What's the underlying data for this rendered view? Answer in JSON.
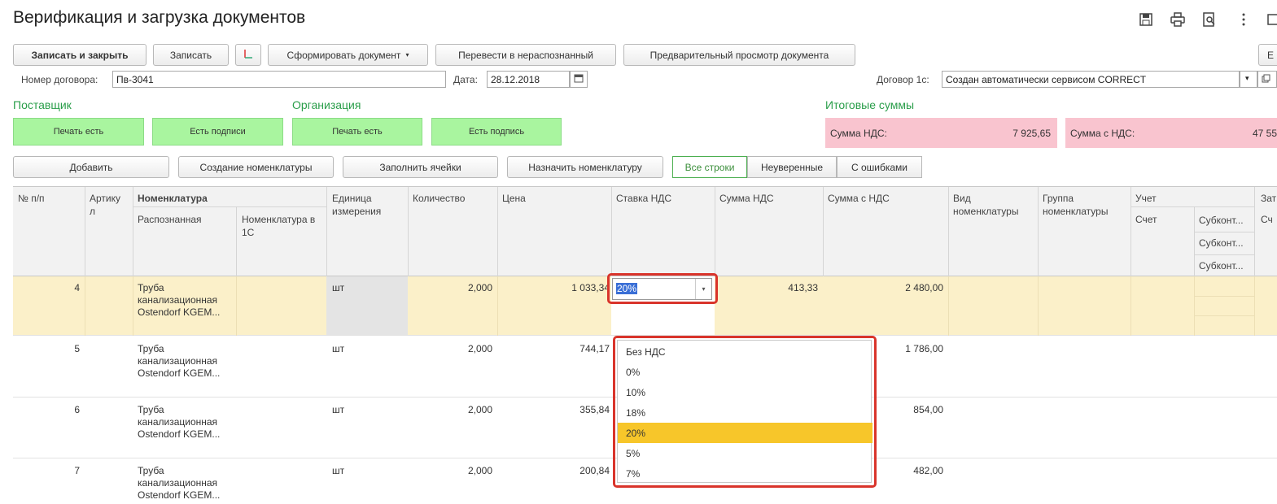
{
  "title": "Верификация и загрузка документов",
  "toolbar": {
    "save_close": "Записать и закрыть",
    "save": "Записать",
    "form_doc": "Сформировать документ",
    "to_unrecognized": "Перевести в нераспознанный",
    "preview": "Предварительный просмотр документа",
    "more": "Е"
  },
  "form": {
    "contract_label": "Номер договора:",
    "contract_value": "Пв-3041",
    "date_label": "Дата:",
    "date_value": "28.12.2018",
    "contract1c_label": "Договор 1с:",
    "contract1c_value": "Создан автоматически сервисом CORRECT"
  },
  "sections": {
    "supplier": "Поставщик",
    "org": "Организация",
    "totals": "Итоговые суммы"
  },
  "status": {
    "sup_stamp": "Печать есть",
    "sup_sign": "Есть подписи",
    "org_stamp": "Печать есть",
    "org_sign": "Есть подпись"
  },
  "totals": {
    "vat_label": "Сумма НДС:",
    "vat_value": "7 925,65",
    "with_vat_label": "Сумма с НДС:",
    "with_vat_value": "47 55"
  },
  "actions": {
    "add": "Добавить",
    "create_nom": "Создание номенклатуры",
    "fill": "Заполнить ячейки",
    "assign": "Назначить номенклатуру",
    "filter_all": "Все строки",
    "filter_uncertain": "Неуверенные",
    "filter_errors": "С ошибками"
  },
  "columns": {
    "num": "№ п/п",
    "article": "Артику л",
    "nom": "Номенклатура",
    "recognized": "Распознанная",
    "nom1c": "Номенклатура в 1С",
    "unit": "Единица измерения",
    "qty": "Количество",
    "price": "Цена",
    "vat_rate": "Ставка НДС",
    "vat_sum": "Сумма НДС",
    "sum_vat": "Сумма с НДС",
    "nom_type": "Вид номенклатуры",
    "nom_group": "Группа номенклатуры",
    "account": "Учет",
    "acc": "Счет",
    "sub1": "Субконт...",
    "sub2": "Субконт...",
    "sub3": "Субконт...",
    "za": "Зат",
    "sch": "Сч"
  },
  "rows": [
    {
      "num": "4",
      "name": "Труба канализационная Ostendorf KGEM...",
      "unit": "шт",
      "qty": "2,000",
      "price": "1 033,34",
      "vat_rate": "20%",
      "vat_sum": "413,33",
      "sum": "2 480,00"
    },
    {
      "num": "5",
      "name": "Труба канализационная Ostendorf KGEM...",
      "unit": "шт",
      "qty": "2,000",
      "price": "744,17",
      "sum": "1 786,00"
    },
    {
      "num": "6",
      "name": "Труба канализационная Ostendorf KGEM...",
      "unit": "шт",
      "qty": "2,000",
      "price": "355,84",
      "sum": "854,00"
    },
    {
      "num": "7",
      "name": "Труба канализационная Ostendorf KGEM...",
      "unit": "шт",
      "qty": "2,000",
      "price": "200,84",
      "sum": "482,00"
    }
  ],
  "dropdown": {
    "options": [
      "Без НДС",
      "0%",
      "10%",
      "18%",
      "20%",
      "5%",
      "7%"
    ],
    "selected": "20%"
  }
}
